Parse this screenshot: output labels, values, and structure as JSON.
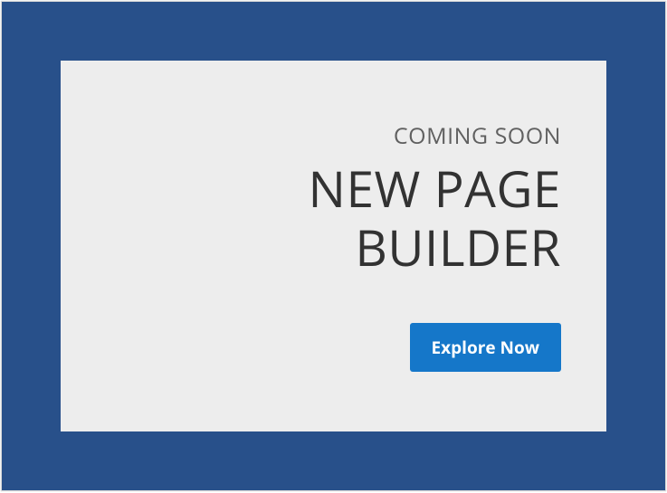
{
  "hero": {
    "eyebrow": "COMING SOON",
    "headline": "NEW PAGE BUILDER",
    "cta_label": "Explore Now"
  },
  "colors": {
    "frame_bg": "#28508a",
    "card_bg": "#ededed",
    "eyebrow_text": "#606060",
    "headline_text": "#323232",
    "button_bg": "#1577c9",
    "button_text": "#ffffff"
  }
}
